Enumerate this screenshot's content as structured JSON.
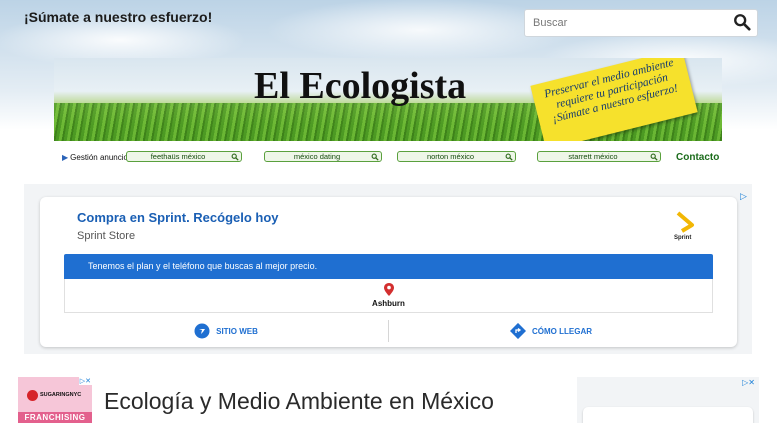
{
  "header": {
    "tagline": "¡Súmate a nuestro esfuerzo!",
    "search": {
      "placeholder": "Buscar",
      "value": ""
    }
  },
  "banner": {
    "title": "El Ecologista",
    "sticker_lines": [
      "Preservar el medio ambiente",
      "requiere tu participación",
      "¡Súmate a nuestro esfuerzo!"
    ]
  },
  "nav": {
    "gestion": "Gestión anuncios",
    "links": [
      "feethaüs méxico",
      "méxico dating",
      "norton méxico",
      "starrett méxico"
    ],
    "contacto": "Contacto"
  },
  "ad": {
    "headline": "Compra en Sprint. Recógelo hoy",
    "advertiser": "Sprint Store",
    "brand": "Sprint",
    "description": "Tenemos el plan y el teléfono que buscas al mejor precio.",
    "location": "Ashburn",
    "action_web": "SITIO WEB",
    "action_directions": "CÓMO LLEGAR"
  },
  "bottom": {
    "heading": "Ecología y Medio Ambiente en México",
    "left_ad_logo": "SUGARINGNYC",
    "left_ad_text": "FRANCHISING"
  },
  "colors": {
    "accent_blue": "#1f6fd1",
    "nav_green": "#5aa03d",
    "sticker_yellow": "#f6e12c"
  }
}
